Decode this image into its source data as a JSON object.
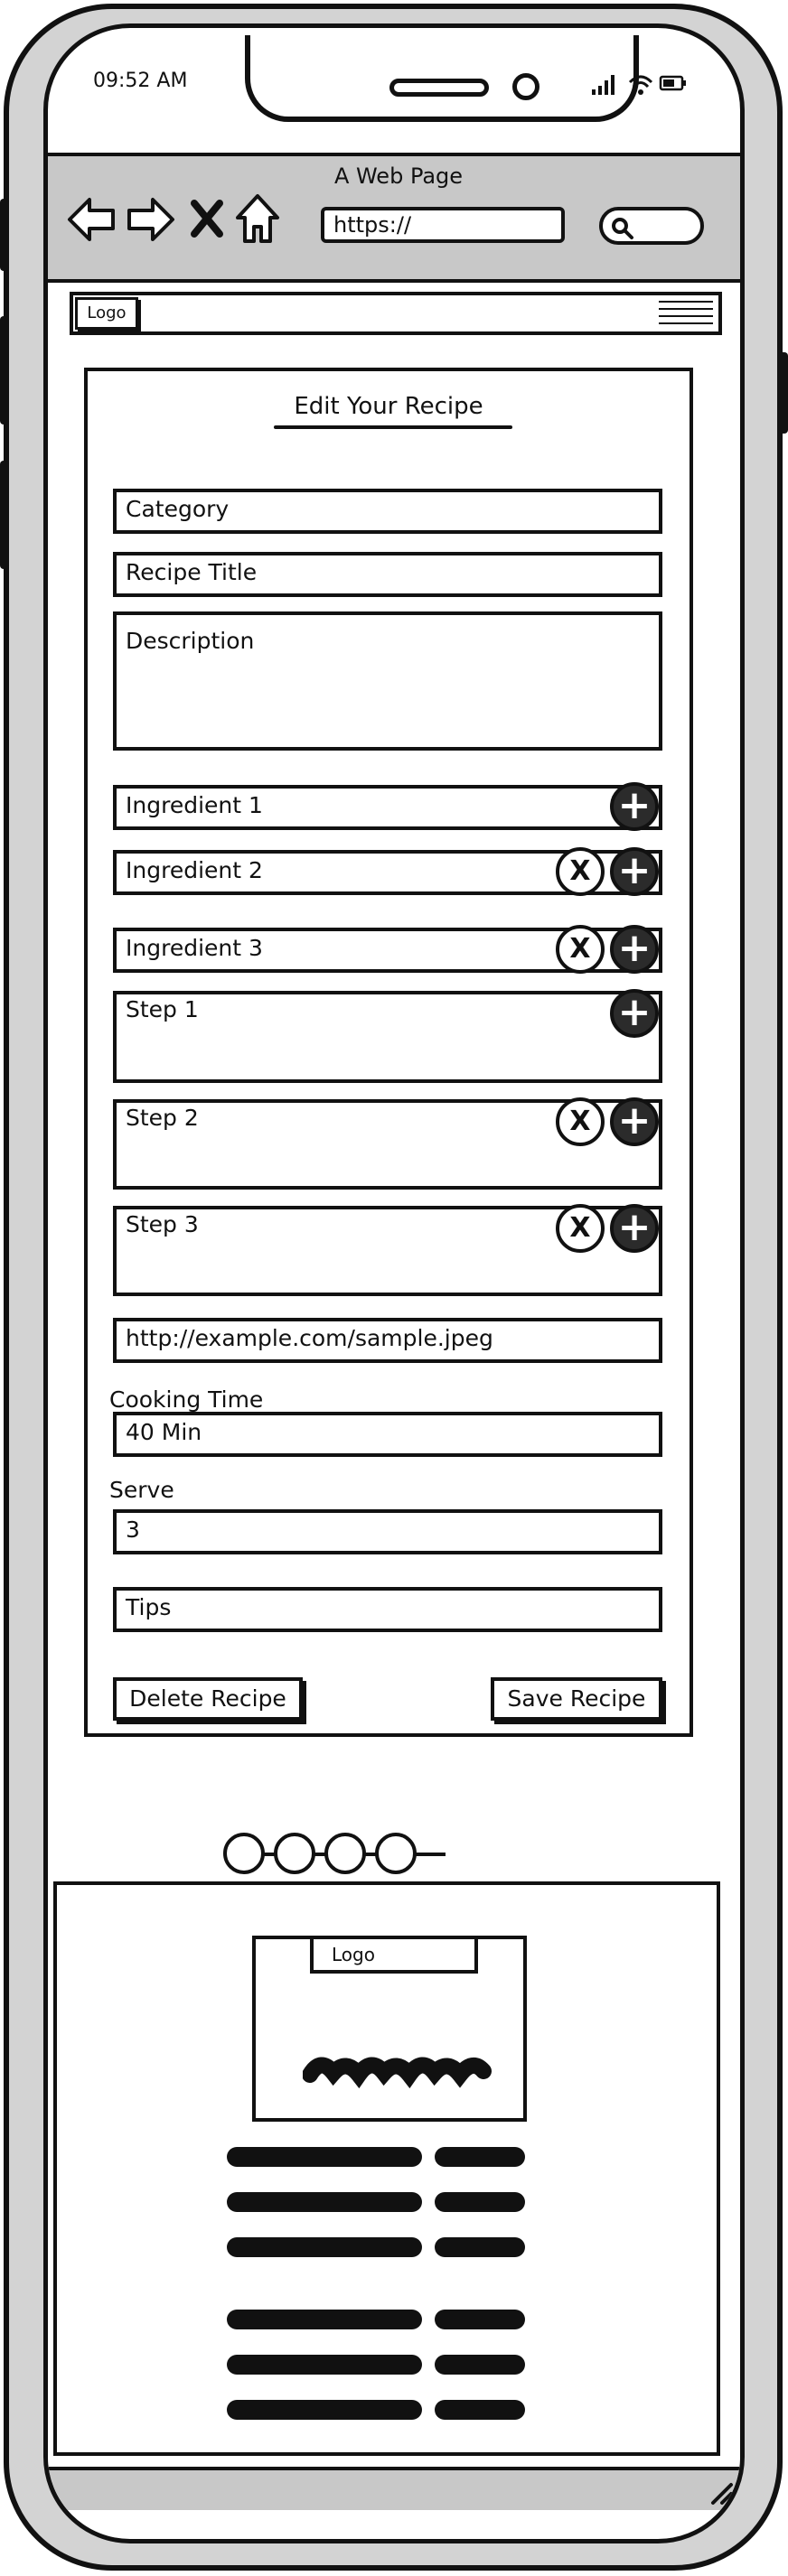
{
  "status_bar": {
    "time": "09:52 AM"
  },
  "browser": {
    "page_title": "A Web Page",
    "url": "https://",
    "icons": [
      "back-arrow-icon",
      "forward-arrow-icon",
      "close-icon",
      "home-icon",
      "search-icon"
    ]
  },
  "header": {
    "logo": "Logo"
  },
  "form": {
    "heading": "Edit Your Recipe",
    "category": "Category",
    "recipe_title": "Recipe Title",
    "description": "Description",
    "ingredients": [
      "Ingredient 1",
      "Ingredient 2",
      "Ingredient 3"
    ],
    "steps": [
      "Step 1",
      "Step 2",
      "Step 3"
    ],
    "image_url": "http://example.com/sample.jpeg",
    "cooking_time_label": "Cooking Time",
    "cooking_time": "40 Min",
    "serve_label": "Serve",
    "serve": "3",
    "tips": "Tips",
    "delete_button": "Delete Recipe",
    "save_button": "Save Recipe",
    "add_symbol": "+",
    "remove_symbol": "X"
  },
  "footer": {
    "logo": "Logo"
  }
}
